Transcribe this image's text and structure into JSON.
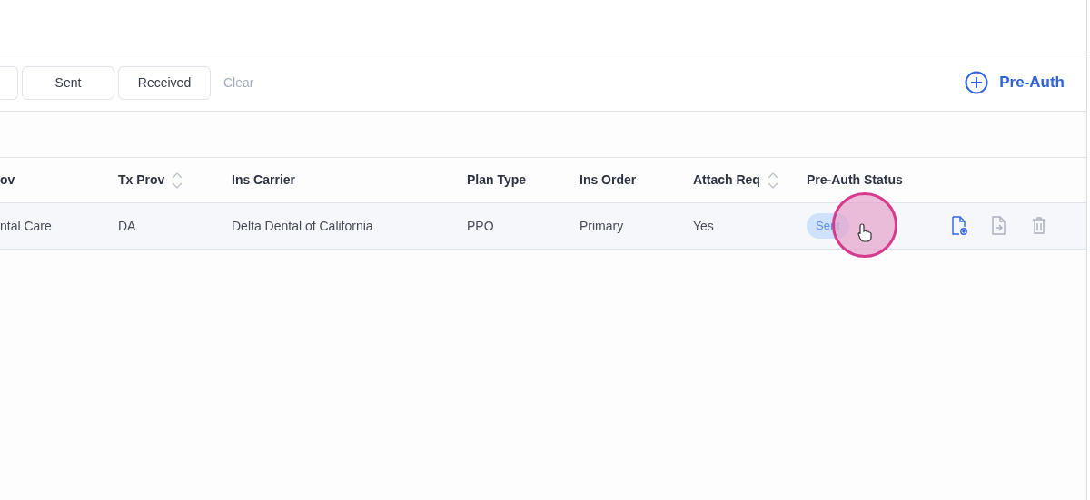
{
  "filters": [
    {
      "label": "Sent"
    },
    {
      "label": "Received"
    }
  ],
  "clear_label": "Clear",
  "add_button": {
    "label": "Pre-Auth"
  },
  "table": {
    "columns": [
      {
        "label": "ov",
        "sortable": false
      },
      {
        "label": "Tx Prov",
        "sortable": true
      },
      {
        "label": "Ins Carrier",
        "sortable": false
      },
      {
        "label": "Plan Type",
        "sortable": false
      },
      {
        "label": "Ins Order",
        "sortable": false
      },
      {
        "label": "Attach Req",
        "sortable": true
      },
      {
        "label": "Pre-Auth Status",
        "sortable": false
      }
    ],
    "rows": [
      {
        "cells": [
          "ntal Care",
          "DA",
          "Delta Dental of California",
          "PPO",
          "Primary",
          "Yes"
        ],
        "status": "Sent",
        "actions": [
          {
            "kind": "view",
            "disabled": false
          },
          {
            "kind": "send",
            "disabled": true
          },
          {
            "kind": "delete",
            "disabled": true
          }
        ]
      }
    ]
  }
}
